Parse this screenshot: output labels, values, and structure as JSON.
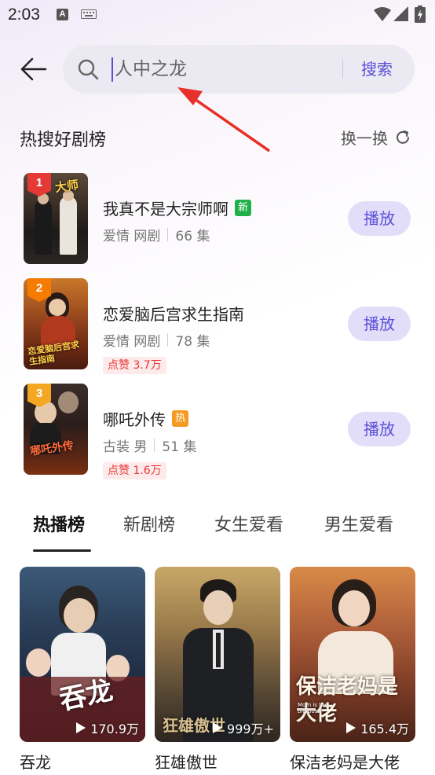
{
  "status_bar": {
    "time": "2:03",
    "notification_letter": "A"
  },
  "search": {
    "placeholder": "人中之龙",
    "button_label": "搜索"
  },
  "hot_search": {
    "title": "热搜好剧榜",
    "refresh_label": "换一换",
    "items": [
      {
        "rank": "1",
        "title": "我真不是大宗师啊",
        "tag": "新",
        "genre": "爱情 网剧",
        "episodes": "66 集",
        "likes": "",
        "play_label": "播放",
        "poster_text": "大师",
        "rank_color": "#e53935"
      },
      {
        "rank": "2",
        "title": "恋爱脑后宫求生指南",
        "tag": "",
        "genre": "爱情 网剧",
        "episodes": "78 集",
        "likes": "点赞 3.7万",
        "play_label": "播放",
        "poster_text": "恋爱脑后宫求生指南",
        "rank_color": "#f57c00"
      },
      {
        "rank": "3",
        "title": "哪吒外传",
        "tag": "热",
        "genre": "古装 男",
        "episodes": "51 集",
        "likes": "点赞 1.6万",
        "play_label": "播放",
        "poster_text": "哪吒外传",
        "rank_color": "#f5a623"
      }
    ]
  },
  "tabs": [
    {
      "label": "热播榜",
      "active": true
    },
    {
      "label": "新剧榜",
      "active": false
    },
    {
      "label": "女生爱看",
      "active": false
    },
    {
      "label": "男生爱看",
      "active": false
    }
  ],
  "cards": [
    {
      "title": "吞龙",
      "count": "170.9万",
      "art_text": "吞龙"
    },
    {
      "title": "狂雄傲世",
      "count": "999万+",
      "art_text": "狂雄傲世"
    },
    {
      "title": "保洁老妈是大佬",
      "count": "165.4万",
      "art_text": "保洁老妈是大佬",
      "art_subtext": "Mom is the big boss"
    }
  ],
  "colors": {
    "accent": "#5b4fd8",
    "play_button_bg": "#e2defa",
    "new_tag": "#20b04a",
    "hot_tag": "#f59a23",
    "likes_text": "#e53935",
    "annotation_arrow": "#e8302a"
  },
  "icons": [
    "back-arrow-icon",
    "search-icon",
    "refresh-icon",
    "play-triangle-icon",
    "wifi-icon",
    "signal-icon",
    "battery-icon",
    "keyboard-icon"
  ]
}
